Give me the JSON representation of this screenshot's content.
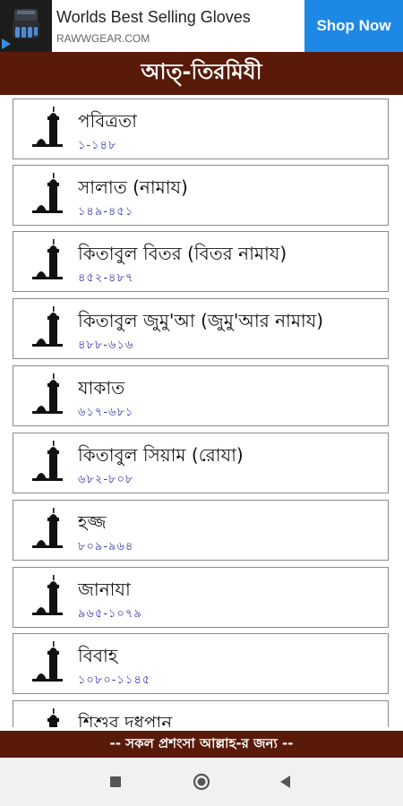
{
  "ad": {
    "title": "Worlds Best Selling Gloves",
    "domain": "RAWWGEAR.COM",
    "cta": "Shop Now",
    "cta_color": "#1e88e5"
  },
  "header": {
    "title": "আত্-তিরমিযী",
    "color": "#5a1a0a"
  },
  "items": [
    {
      "title": "পবিত্রতা",
      "range": "১-১৪৮"
    },
    {
      "title": "সালাত (নামায)",
      "range": "১৪৯-৪৫১"
    },
    {
      "title": "কিতাবুল বিতর (বিতর নামায)",
      "range": "৪৫২-৪৮৭"
    },
    {
      "title": "কিতাবুল জুমু'আ (জুমু'আর নামায)",
      "range": "৪৮৮-৬১৬"
    },
    {
      "title": "যাকাত",
      "range": "৬১৭-৬৮১"
    },
    {
      "title": "কিতাবুল সিয়াম (রোযা)",
      "range": "৬৮২-৮০৮"
    },
    {
      "title": "হজ্জ",
      "range": "৮০৯-৯৬৪"
    },
    {
      "title": "জানাযা",
      "range": "৯৬৫-১০৭৯"
    },
    {
      "title": "বিবাহ",
      "range": "১০৮০-১১৪৫"
    },
    {
      "title": "শিশুর দুধপান",
      "range": ""
    }
  ],
  "footer": {
    "text": "-- সকল প্রশংসা আল্লাহ-র জন্য --"
  },
  "nav": {
    "icons": [
      "recents-square-icon",
      "home-circle-icon",
      "back-triangle-icon"
    ]
  }
}
